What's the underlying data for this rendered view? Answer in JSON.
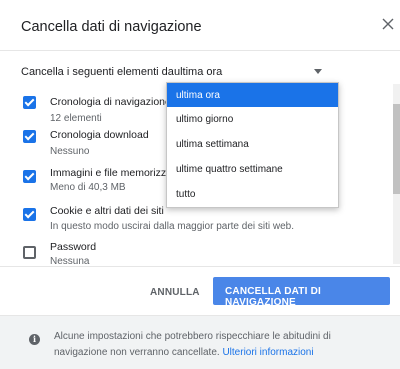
{
  "dialog": {
    "title": "Cancella dati di navigazione",
    "close_glyph": "×",
    "period_label": "Cancella i seguenti elementi da",
    "period_value": "ultima ora"
  },
  "dropdown": {
    "options": [
      "ultima ora",
      "ultimo giorno",
      "ultima settimana",
      "ultime quattro settimane",
      "tutto"
    ],
    "selected": "ultima ora"
  },
  "items": [
    {
      "title": "Cronologia di navigazione",
      "subtitle": "12 elementi",
      "checked": true
    },
    {
      "title": "Cronologia download",
      "subtitle": "Nessuno",
      "checked": true
    },
    {
      "title": "Immagini e file memorizzati",
      "subtitle": "Meno di 40,3 MB",
      "checked": true
    },
    {
      "title": "Cookie e altri dati dei siti",
      "subtitle": "In questo modo uscirai dalla maggior parte dei siti web.",
      "checked": true
    },
    {
      "title": "Password",
      "subtitle": "Nessuna",
      "checked": false
    }
  ],
  "buttons": {
    "cancel": "ANNULLA",
    "confirm": "CANCELLA DATI DI NAVIGAZIONE"
  },
  "footer": {
    "text": "Alcune impostazioni che potrebbero rispecchiare le abitudini di navigazione non verranno cancellate.",
    "link": "Ulteriori informazioni"
  },
  "colors": {
    "accent": "#1a73e8",
    "button": "#4a86e8"
  },
  "icons": {
    "close": "close-icon",
    "dropdown": "chevron-down-icon",
    "info": "info-icon",
    "checkbox_on": "checkbox-checked-icon",
    "checkbox_off": "checkbox-unchecked-icon"
  }
}
